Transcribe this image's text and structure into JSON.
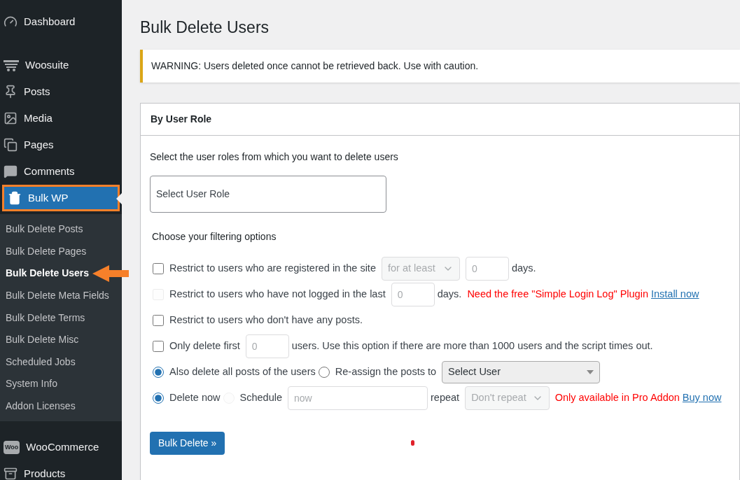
{
  "sidebar": {
    "items": [
      {
        "label": "Dashboard",
        "selected": false
      },
      {
        "label": "Woosuite",
        "selected": false
      },
      {
        "label": "Posts",
        "selected": false
      },
      {
        "label": "Media",
        "selected": false
      },
      {
        "label": "Pages",
        "selected": false
      },
      {
        "label": "Comments",
        "selected": false
      },
      {
        "label": "Bulk WP",
        "selected": true,
        "highlighted": true,
        "children": [
          {
            "label": "Bulk Delete Posts",
            "selected": false
          },
          {
            "label": "Bulk Delete Pages",
            "selected": false
          },
          {
            "label": "Bulk Delete Users",
            "selected": true
          },
          {
            "label": "Bulk Delete Meta Fields",
            "selected": false
          },
          {
            "label": "Bulk Delete Terms",
            "selected": false
          },
          {
            "label": "Bulk Delete Misc",
            "selected": false
          },
          {
            "label": "Scheduled Jobs",
            "selected": false
          },
          {
            "label": "System Info",
            "selected": false
          },
          {
            "label": "Addon Licenses",
            "selected": false
          }
        ]
      },
      {
        "label": "WooCommerce",
        "selected": false,
        "icon_text": "Woo"
      },
      {
        "label": "Products",
        "selected": false
      }
    ]
  },
  "page": {
    "title": "Bulk Delete Users",
    "warning": "WARNING: Users deleted once cannot be retrieved back. Use with caution."
  },
  "panel": {
    "title": "By User Role",
    "intro": "Select the user roles from which you want to delete users",
    "role_select": {
      "placeholder": "Select User Role"
    },
    "filter_heading": "Choose your filtering options",
    "options": [
      {
        "parts": [
          {
            "kind": "checkbox",
            "checked": false,
            "disabled": false
          },
          {
            "kind": "text",
            "text": "Restrict to users who are registered in the site"
          },
          {
            "kind": "select",
            "value": "for at least",
            "disabled": true
          },
          {
            "kind": "input",
            "placeholder": "0"
          },
          {
            "kind": "text",
            "text": "days."
          }
        ]
      },
      {
        "parts": [
          {
            "kind": "checkbox",
            "checked": false,
            "disabled": true
          },
          {
            "kind": "text",
            "text": "Restrict to users who have not logged in the last"
          },
          {
            "kind": "input",
            "placeholder": "0"
          },
          {
            "kind": "text",
            "text": "days."
          },
          {
            "kind": "warning",
            "text": "Need the free \"Simple Login Log\" Plugin"
          },
          {
            "kind": "link",
            "text": "Install now"
          }
        ]
      },
      {
        "parts": [
          {
            "kind": "checkbox",
            "checked": false,
            "disabled": false
          },
          {
            "kind": "text",
            "text": "Restrict to users who don't have any posts."
          }
        ]
      },
      {
        "parts": [
          {
            "kind": "checkbox",
            "checked": false,
            "disabled": false
          },
          {
            "kind": "text",
            "text": "Only delete first"
          },
          {
            "kind": "input",
            "placeholder": "0"
          },
          {
            "kind": "text",
            "text": "users. Use this option if there are more than 1000 users and the script times out."
          }
        ]
      },
      {
        "parts": [
          {
            "kind": "radio",
            "selected": true,
            "disabled": false
          },
          {
            "kind": "text",
            "text": "Also delete all posts of the users"
          },
          {
            "kind": "radio",
            "selected": false,
            "disabled": false
          },
          {
            "kind": "text",
            "text": "Re-assign the posts to"
          },
          {
            "kind": "dropdown",
            "value": "Select User",
            "disabled": false
          }
        ]
      },
      {
        "parts": [
          {
            "kind": "radio",
            "selected": true,
            "disabled": false
          },
          {
            "kind": "text",
            "text": "Delete now"
          },
          {
            "kind": "radio",
            "selected": false,
            "disabled": true
          },
          {
            "kind": "text",
            "text": "Schedule"
          },
          {
            "kind": "wideinput",
            "placeholder": "now"
          },
          {
            "kind": "text",
            "text": "repeat"
          },
          {
            "kind": "select",
            "value": "Don't repeat",
            "disabled": true
          },
          {
            "kind": "warning",
            "text": "Only available in Pro Addon"
          },
          {
            "kind": "link",
            "text": "Buy now"
          }
        ]
      }
    ],
    "button": "Bulk Delete »"
  }
}
